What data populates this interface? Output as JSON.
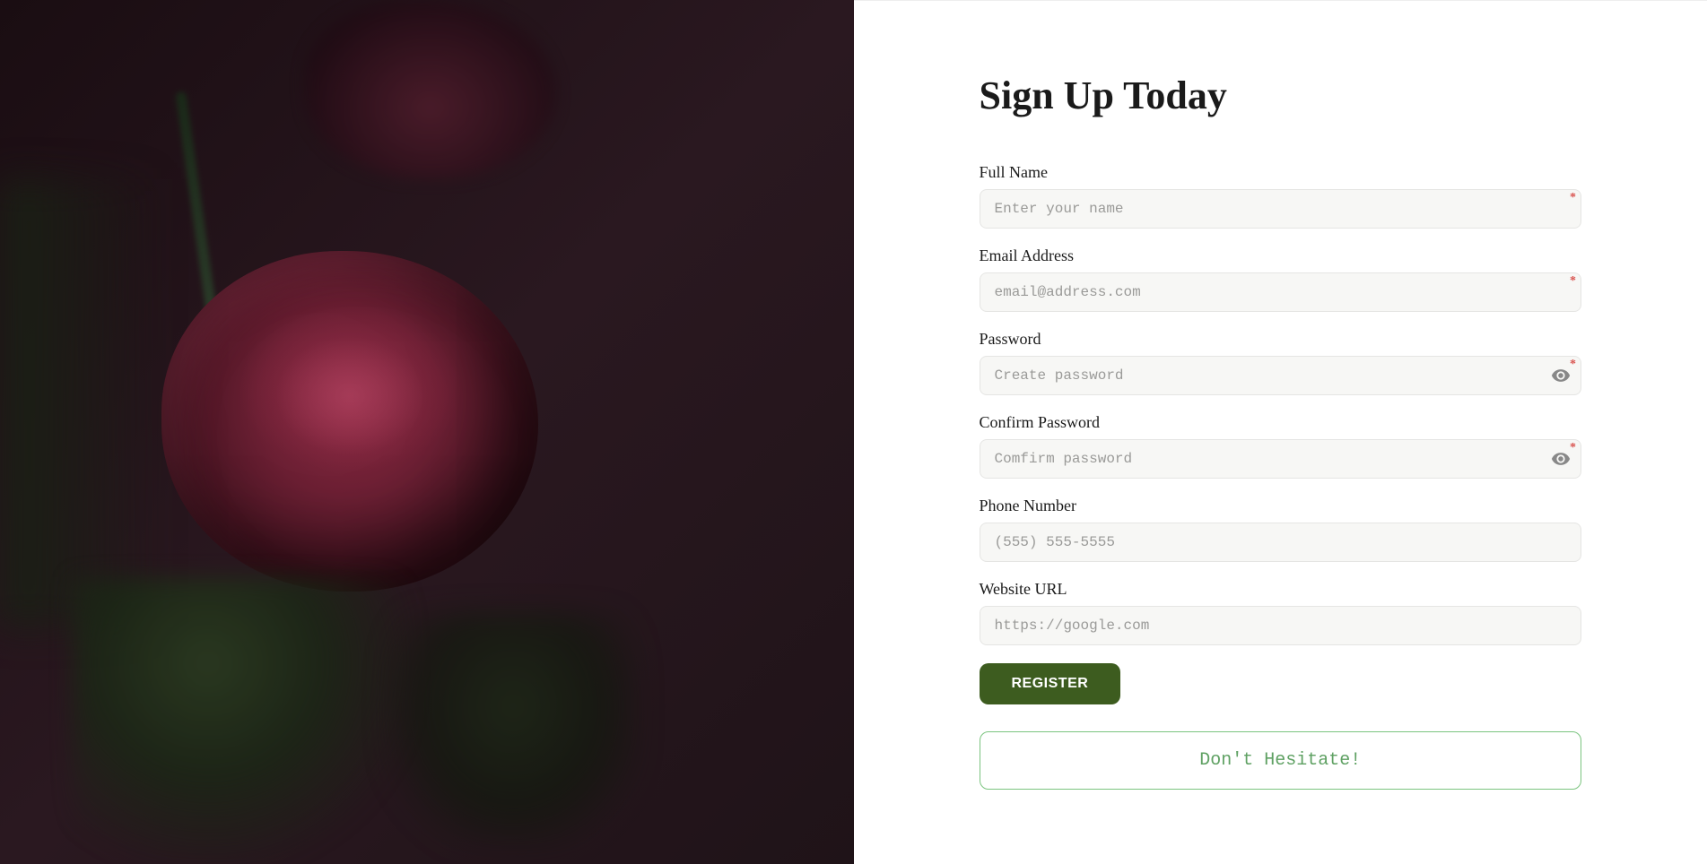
{
  "title": "Sign Up Today",
  "fields": {
    "fullName": {
      "label": "Full Name",
      "placeholder": "Enter your name",
      "required": "*"
    },
    "email": {
      "label": "Email Address",
      "placeholder": "email@address.com",
      "required": "*"
    },
    "password": {
      "label": "Password",
      "placeholder": "Create password",
      "required": "*"
    },
    "confirmPassword": {
      "label": "Confirm Password",
      "placeholder": "Comfirm password",
      "required": "*"
    },
    "phone": {
      "label": "Phone Number",
      "placeholder": "(555) 555-5555"
    },
    "website": {
      "label": "Website URL",
      "placeholder": "https://google.com"
    }
  },
  "buttons": {
    "register": "REGISTER"
  },
  "cta": {
    "text": "Don't Hesitate!"
  }
}
